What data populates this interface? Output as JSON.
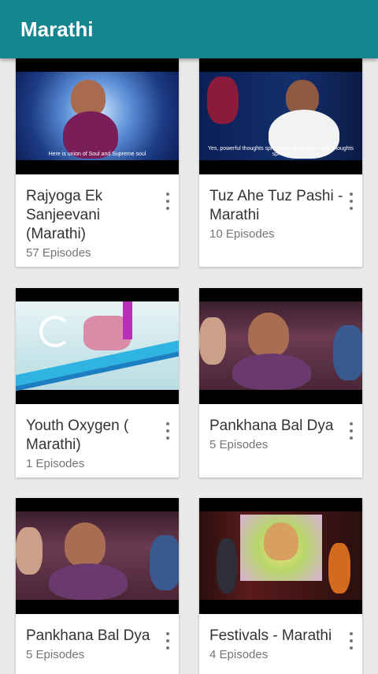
{
  "appbar": {
    "title": "Marathi"
  },
  "cards": [
    {
      "title": "Rajyoga Ek Sanjeevani (Marathi)",
      "episodes": "57 Episodes",
      "subtitle": "Here is union of Soul and Supreme soul"
    },
    {
      "title": "Tuz Ahe Tuz Pashi - Marathi",
      "episodes": "10 Episodes",
      "subtitle": "Yes, powerful thoughts spread far away than small thoughts spread"
    },
    {
      "title": "Youth Oxygen ( Marathi)",
      "episodes": "1 Episodes"
    },
    {
      "title": "Pankhana Bal Dya",
      "episodes": "5 Episodes"
    },
    {
      "title": "Pankhana Bal Dya",
      "episodes": "5 Episodes"
    },
    {
      "title": "Festivals - Marathi",
      "episodes": "4 Episodes"
    }
  ],
  "colors": {
    "appbar": "#15858e",
    "background": "#eaeaea",
    "card": "#ffffff"
  },
  "icons": {
    "overflow": "more-vert-icon"
  }
}
